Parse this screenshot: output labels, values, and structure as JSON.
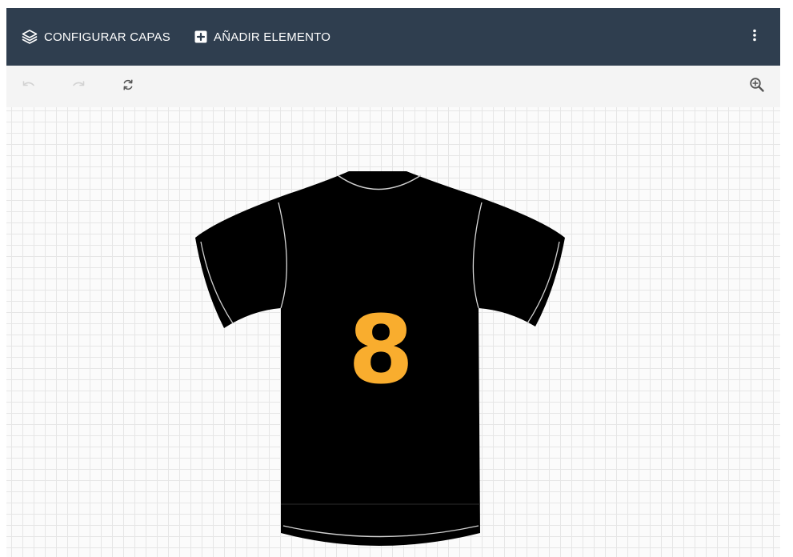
{
  "header": {
    "layers_label": "CONFIGURAR CAPAS",
    "layers_icon": "layers-icon",
    "add_label": "AÑADIR ELEMENTO",
    "add_icon": "add-box-icon",
    "more_icon": "more-vertical-icon"
  },
  "toolbar": {
    "undo_icon": "undo-icon",
    "redo_icon": "redo-icon",
    "refresh_icon": "refresh-icon",
    "zoom_icon": "zoom-in-icon"
  },
  "design": {
    "number": "8",
    "shirt_color": "#000000",
    "number_color": "#f9ad2e",
    "trim_color": "#cfcfcf"
  },
  "colors": {
    "header_bg": "#2f3e4f",
    "toolbar_bg": "#f4f4f4"
  }
}
